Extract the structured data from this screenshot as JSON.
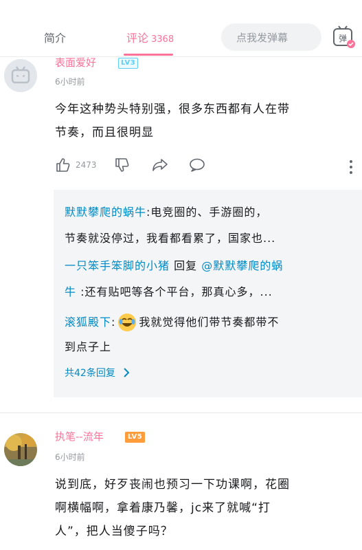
{
  "tabs": {
    "intro": "简介",
    "comments": "评论",
    "comment_count": "3368",
    "danmaku_placeholder": "点我发弹幕",
    "danmaku_button": "弹"
  },
  "comments": [
    {
      "username": "表面爱好",
      "level": "LV3",
      "time": "6小时前",
      "text_line1": "今年这种势头特别强，很多东西都有人在带",
      "text_line2": "节奏，而且很明显",
      "likes": "2473",
      "replies": [
        {
          "user": "默默攀爬的蜗牛",
          "text": ":电竞圈的、手游圈的，",
          "cont": "节奏就没停过，我看都看累了，国家也..."
        },
        {
          "user": "一只笨手笨脚的小猪",
          "mid": " 回复 ",
          "target": "@默默攀爬的蜗",
          "target_cont": "牛",
          "text": " :还有贴吧等各个平台，那真心多，..."
        },
        {
          "user": "滚狐殿下",
          "text": " 我就觉得他们带节奏都带不",
          "cont": "到点子上"
        }
      ],
      "view_all": "共42条回复"
    },
    {
      "username": "执笔--流年",
      "level": "LV5",
      "time": "6小时前",
      "text_line1": "说到底，好歹丧闹也预习一下功课啊，花圈",
      "text_line2": "啊横幅啊，拿着康乃馨，jc来了就喊“打",
      "text_line3": "人”，把人当傻子吗？"
    }
  ],
  "colors": {
    "accent": "#fb7299",
    "link": "#008ac5",
    "lv3": "#5fcdf5",
    "lv5": "#ff9d3d"
  }
}
